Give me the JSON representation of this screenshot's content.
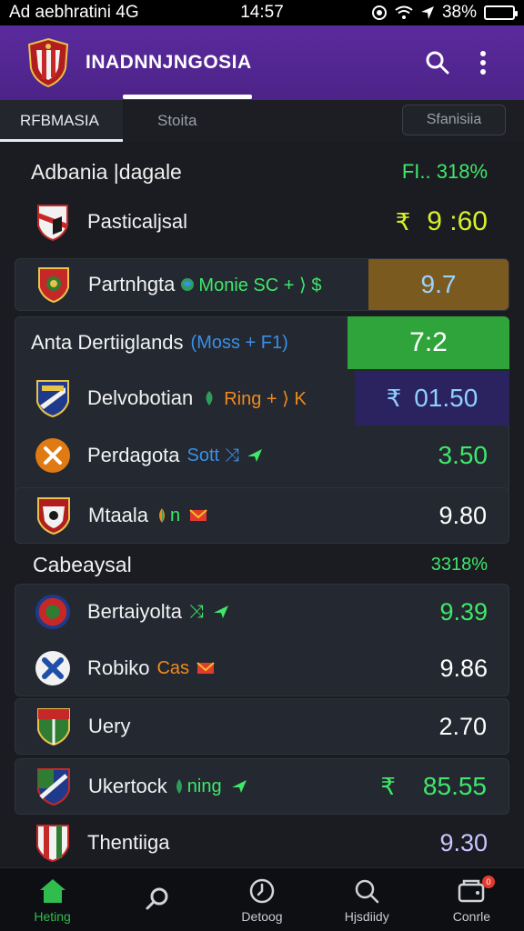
{
  "status_bar": {
    "carrier": "Ad aebhratini 4G",
    "time": "14:57",
    "battery": "38%",
    "battery_level": 0.38
  },
  "app_bar": {
    "title": "INADNNJNGOSIA",
    "search_icon": "search-icon",
    "menu_icon": "more-vertical-icon"
  },
  "tabs": {
    "items": [
      {
        "label": "RFBMASIA",
        "active": true
      },
      {
        "label": "Stoita",
        "active": false
      }
    ],
    "right_button": "Sfanisiia"
  },
  "sections": [
    {
      "title": "Adbania |dagale",
      "value": "FI.. 318%"
    },
    {
      "title": "Cabeaysal",
      "value": "3318%"
    }
  ],
  "rows": [
    {
      "name": "Pasticaljsal",
      "tags": "",
      "currency": "₹",
      "odds": "9 :60"
    },
    {
      "name": "Partnhgta",
      "tags": "Monie SC + ⟩ $",
      "odds": "9.7"
    },
    {
      "name": "Anta Dertiiglands",
      "tags": "(Moss + F1)",
      "odds": "7:2"
    },
    {
      "name": "Delvobotian",
      "tags": "Ring + ⟩ K",
      "currency": "₹",
      "odds": "01.50"
    },
    {
      "name": "Perdagota",
      "tags": "Sott",
      "odds": "3.50"
    },
    {
      "name": "Mtaala",
      "tags": "n",
      "odds": "9.80"
    },
    {
      "name": "Bertaiyolta",
      "tags": "",
      "odds": "9.39"
    },
    {
      "name": "Robiko",
      "tags": "Cas",
      "odds": "9.86"
    },
    {
      "name": "Uery",
      "tags": "",
      "odds": "2.70"
    },
    {
      "name": "Ukertock",
      "tags": "ning",
      "currency": "₹",
      "odds": "85.55"
    },
    {
      "name": "Thentiiga",
      "tags": "",
      "odds": "9.30"
    }
  ],
  "bottom_nav": [
    {
      "label": "Heting",
      "icon": "home-icon",
      "active": true
    },
    {
      "label": "",
      "icon": "magnifier-icon",
      "active": false
    },
    {
      "label": "Detoog",
      "icon": "clock-icon",
      "active": false
    },
    {
      "label": "Hjsdiidy",
      "icon": "search-icon",
      "active": false
    },
    {
      "label": "Conrle",
      "icon": "wallet-icon",
      "active": false,
      "badge": "0"
    }
  ],
  "colors": {
    "app_bar": "#5b2a9e",
    "background": "#1a1c21",
    "card": "#242830",
    "accent_green": "#3ee86a",
    "lime": "#d8f02a",
    "gold_box": "#7a5a1e",
    "green_box": "#2fa43a",
    "purple_box": "#2b2260",
    "link_blue": "#3a8fe8",
    "orange": "#f08a1e"
  }
}
